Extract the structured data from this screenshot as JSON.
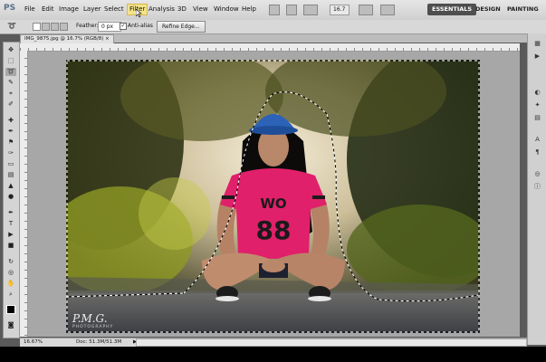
{
  "menubar": {
    "logo": "PS",
    "items": [
      "File",
      "Edit",
      "Image",
      "Layer",
      "Select",
      "Filter",
      "Analysis",
      "3D",
      "View",
      "Window",
      "Help"
    ],
    "active_item": "Filter",
    "zoom_value": "16.7",
    "workspaces": [
      "ESSENTIALS",
      "DESIGN",
      "PAINTING"
    ]
  },
  "options": {
    "feather_label": "Feather:",
    "feather_value": "0 px",
    "antialias_label": "Anti-alias",
    "refine_edge": "Refine Edge..."
  },
  "document": {
    "tab_title": "IMG_9875.jpg @ 16.7% (RGB/8)",
    "zoom_status": "16.67%",
    "doc_size": "Doc: 51.3M/51.3M"
  },
  "image": {
    "watermark": "P.M.G.",
    "watermark_sub": "PHOTOGRAPHY",
    "shirt_text_top": "WO",
    "shirt_text_number": "88"
  }
}
